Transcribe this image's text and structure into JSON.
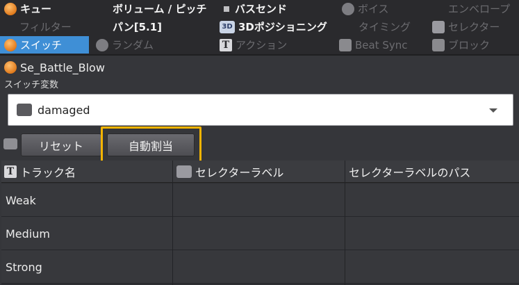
{
  "tabs": [
    {
      "label": "キュー",
      "icon": "cue-icon",
      "state": "bold"
    },
    {
      "label": "ボリューム / ピッチ",
      "icon": "",
      "state": "bold"
    },
    {
      "label": "バスセンド",
      "icon": "square-icon",
      "state": "bold"
    },
    {
      "label": "ボイス",
      "icon": "voice-icon",
      "state": "dim"
    },
    {
      "label": "エンベロープ",
      "icon": "",
      "state": "dim"
    },
    {
      "label": "フィルター",
      "icon": "",
      "state": "dim"
    },
    {
      "label": "パン[5.1]",
      "icon": "",
      "state": "bold"
    },
    {
      "label": "3Dポジショニング",
      "icon": "3d-icon",
      "state": "bold"
    },
    {
      "label": "タイミング",
      "icon": "",
      "state": "dim"
    },
    {
      "label": "セレクター",
      "icon": "selector-icon",
      "state": "dim"
    },
    {
      "label": "スイッチ",
      "icon": "switch-icon",
      "state": "active"
    },
    {
      "label": "ランダム",
      "icon": "random-icon",
      "state": "dim"
    },
    {
      "label": "アクション",
      "icon": "text-icon",
      "state": "dim"
    },
    {
      "label": "Beat Sync",
      "icon": "beat-sync-icon",
      "state": "dim"
    },
    {
      "label": "ブロック",
      "icon": "block-icon",
      "state": "dim"
    }
  ],
  "object": {
    "name": "Se_Battle_Blow"
  },
  "switch_variable": {
    "label": "スイッチ変数",
    "value": "damaged"
  },
  "buttons": {
    "reset": "リセット",
    "auto_assign": "自動割当"
  },
  "highlight_color": "#f4b400",
  "table": {
    "columns": [
      "トラック名",
      "セレクターラベル",
      "セレクターラベルのパス"
    ],
    "rows": [
      {
        "track": "Weak",
        "selector_label": "",
        "path": ""
      },
      {
        "track": "Medium",
        "selector_label": "",
        "path": ""
      },
      {
        "track": "Strong",
        "selector_label": "",
        "path": ""
      }
    ]
  }
}
